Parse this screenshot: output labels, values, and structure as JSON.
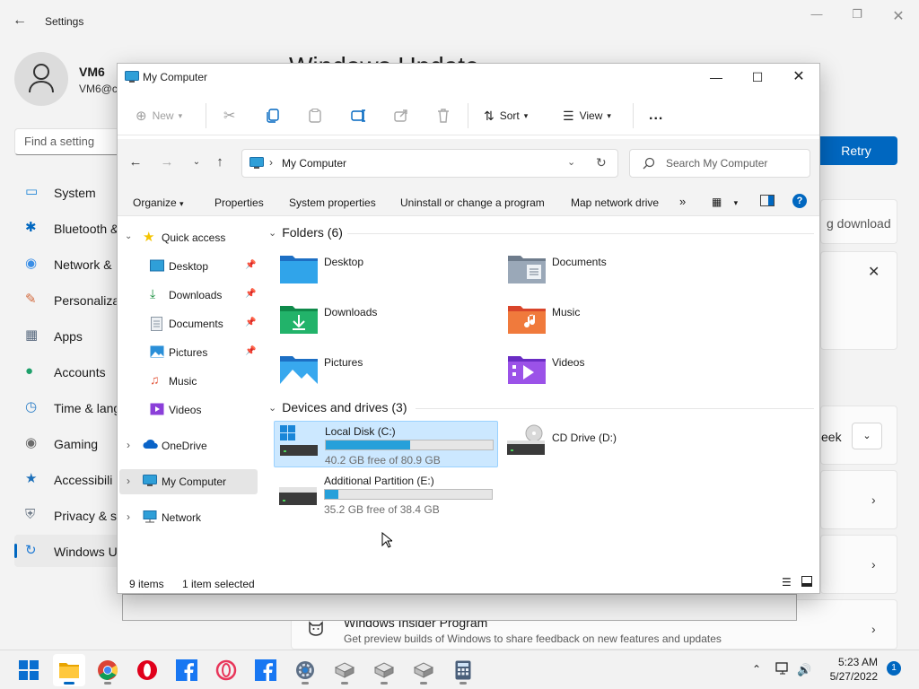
{
  "settings": {
    "title": "Settings",
    "user_name": "VM6",
    "user_email": "VM6@c",
    "find_placeholder": "Find a setting",
    "heading": "Windows Update",
    "retry_label": "Retry",
    "download_text": "g download",
    "week_text": "eek",
    "nav": [
      {
        "label": "System",
        "icon": "monitor-icon"
      },
      {
        "label": "Bluetooth &",
        "icon": "bluetooth-icon"
      },
      {
        "label": "Network &",
        "icon": "wifi-icon"
      },
      {
        "label": "Personaliza",
        "icon": "brush-icon"
      },
      {
        "label": "Apps",
        "icon": "apps-icon"
      },
      {
        "label": "Accounts",
        "icon": "person-icon"
      },
      {
        "label": "Time & lang",
        "icon": "clock-icon"
      },
      {
        "label": "Gaming",
        "icon": "gamepad-icon"
      },
      {
        "label": "Accessibili",
        "icon": "accessibility-icon"
      },
      {
        "label": "Privacy & s",
        "icon": "shield-icon"
      },
      {
        "label": "Windows U",
        "icon": "update-icon"
      }
    ],
    "insider_title": "Windows Insider Program",
    "insider_desc": "Get preview builds of Windows to share feedback on new features and updates"
  },
  "explorer": {
    "title": "My Computer",
    "commands": {
      "new": "New",
      "sort": "Sort",
      "view": "View",
      "more": "..."
    },
    "address": "My Computer",
    "search_placeholder": "Search My Computer",
    "ribbon": {
      "organize": "Organize",
      "properties": "Properties",
      "system_properties": "System properties",
      "uninstall": "Uninstall or change a program",
      "map_drive": "Map network drive",
      "overflow": "»"
    },
    "nav_tree": {
      "quick_access": "Quick access",
      "desktop": "Desktop",
      "downloads": "Downloads",
      "documents": "Documents",
      "pictures": "Pictures",
      "music": "Music",
      "videos": "Videos",
      "onedrive": "OneDrive",
      "my_computer": "My Computer",
      "network": "Network"
    },
    "folders_heading": "Folders (6)",
    "folders": [
      {
        "name": "Desktop"
      },
      {
        "name": "Documents"
      },
      {
        "name": "Downloads"
      },
      {
        "name": "Music"
      },
      {
        "name": "Pictures"
      },
      {
        "name": "Videos"
      }
    ],
    "drives_heading": "Devices and drives (3)",
    "drives": [
      {
        "name": "Local Disk (C:)",
        "free": "40.2 GB free of 80.9 GB",
        "used_fraction": 0.503
      },
      {
        "name": "CD Drive (D:)"
      },
      {
        "name": "Additional Partition (E:)",
        "free": "35.2 GB free of 38.4 GB",
        "used_fraction": 0.083
      }
    ],
    "status": {
      "items": "9 items",
      "selected": "1 item selected"
    }
  },
  "taskbar": {
    "time": "5:23 AM",
    "date": "5/27/2022",
    "notification_count": "1",
    "apps": [
      "start-icon",
      "file-explorer-icon",
      "chrome-icon",
      "opera-icon",
      "facebook-icon",
      "opera-icon",
      "facebook-icon",
      "settings-icon",
      "vm-icon",
      "vm-icon",
      "vm-icon",
      "calculator-icon"
    ]
  },
  "colors": {
    "accent": "#0067c0",
    "selection": "#cce8ff",
    "drive_fill": "#26a0da"
  }
}
